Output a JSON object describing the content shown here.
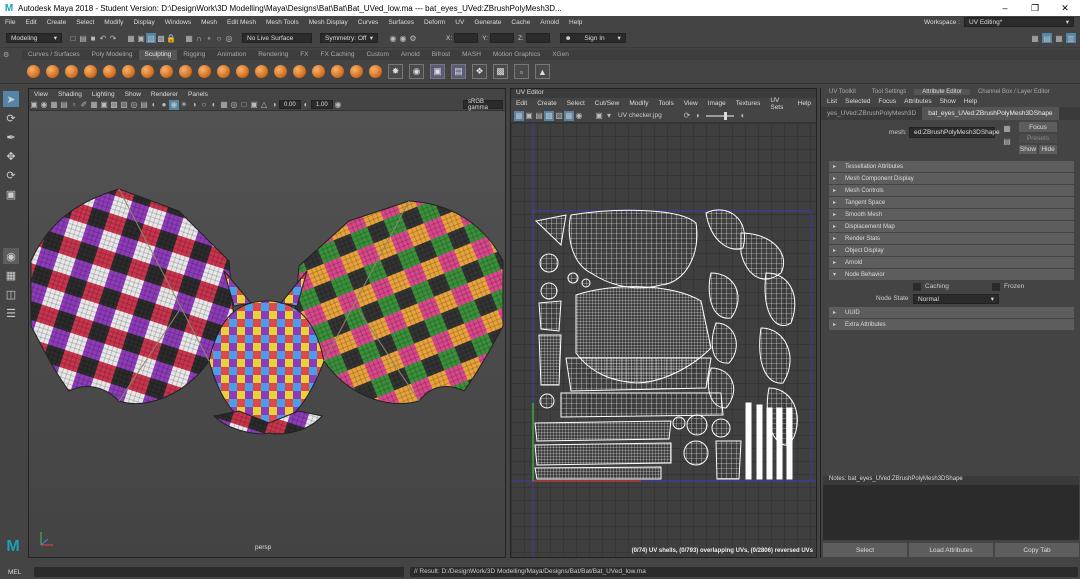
{
  "window": {
    "title": "Autodesk Maya 2018 - Student Version: D:\\DesignWork\\3D Modelling\\Maya\\Designs\\Bat\\Bat\\Bat_UVed_low.ma   ---   bat_eyes_UVed:ZBrushPolyMesh3D..."
  },
  "menubar": {
    "items": [
      "File",
      "Edit",
      "Create",
      "Select",
      "Modify",
      "Display",
      "Windows",
      "Mesh",
      "Edit Mesh",
      "Mesh Tools",
      "Mesh Display",
      "Curves",
      "Surfaces",
      "Deform",
      "UV",
      "Generate",
      "Cache",
      "Arnold",
      "Help"
    ],
    "workspace_label": "Workspace :",
    "workspace_value": "UV Editing*"
  },
  "statusline": {
    "mode": "Modeling",
    "live_surface": "No Live Surface",
    "symmetry": "Symmetry: Off",
    "sign_in": "Sign In",
    "x": "X:",
    "y": "Y:",
    "z": "Z:"
  },
  "shelf": {
    "tabs": [
      "Curves / Surfaces",
      "Poly Modeling",
      "Sculpting",
      "Rigging",
      "Animation",
      "Rendering",
      "FX",
      "FX Caching",
      "Custom",
      "Arnold",
      "Bifrost",
      "MASH",
      "Motion Graphics",
      "XGen"
    ],
    "active": "Sculpting"
  },
  "viewport": {
    "menu": [
      "View",
      "Shading",
      "Lighting",
      "Show",
      "Renderer",
      "Panels"
    ],
    "exposure": "0.00",
    "gamma": "1.00",
    "colorspace": "sRGB gamma",
    "camera": "persp"
  },
  "uv": {
    "title": "UV Editor",
    "menu": [
      "Edit",
      "Create",
      "Select",
      "Cut/Sew",
      "Modify",
      "Tools",
      "View",
      "Image",
      "Textures",
      "UV Sets",
      "Help"
    ],
    "image": "UV checker.jpg",
    "status": "(0/74) UV shells, (0/793) overlapping UVs, (0/2806) reversed UVs"
  },
  "attr": {
    "tabs": [
      "UV Toolkit",
      "Tool Settings",
      "Attribute Editor",
      "Channel Box / Layer Editor"
    ],
    "active_tab": "Attribute Editor",
    "menu": [
      "List",
      "Selected",
      "Focus",
      "Attributes",
      "Show",
      "Help"
    ],
    "node_tabs": [
      "yes_UVed:ZBrushPolyMesh3D",
      "bat_eyes_UVed:ZBrushPolyMesh3DShape"
    ],
    "mesh_label": "mesh:",
    "mesh_value": "ed:ZBrushPolyMesh3DShape",
    "focus": "Focus",
    "presets": "Presets",
    "show": "Show",
    "hide": "Hide",
    "sections": [
      "Tessellation Attributes",
      "Mesh Component Display",
      "Mesh Controls",
      "Tangent Space",
      "Smooth Mesh",
      "Displacement Map",
      "Render Stats",
      "Object Display",
      "Arnold",
      "Node Behavior"
    ],
    "caching": "Caching",
    "frozen": "Frozen",
    "node_state_label": "Node State",
    "node_state": "Normal",
    "uuid": "UUID",
    "extra": "Extra Attributes",
    "notes": "Notes:  bat_eyes_UVed:ZBrushPolyMesh3DShape",
    "buttons": [
      "Select",
      "Load Attributes",
      "Copy Tab"
    ]
  },
  "cmd": {
    "label": "MEL",
    "result": "// Result: D:/DesignWork/3D Modelling/Maya/Designs/Bat/Bat/Bat_UVed_low.ma"
  },
  "colors": {
    "accent": "#5285a6",
    "maya_logo": "#1ba0b8",
    "uv_wire": "#ffffff"
  }
}
